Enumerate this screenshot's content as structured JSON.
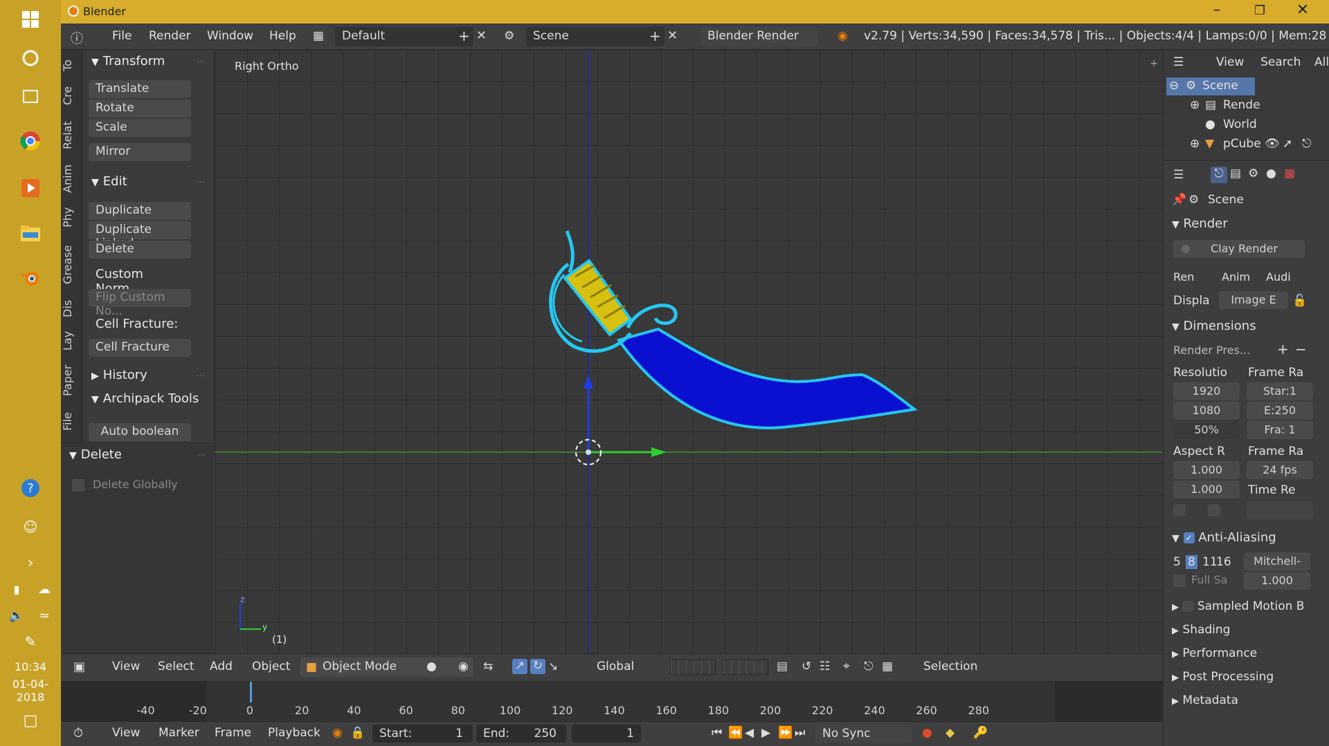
{
  "window": {
    "title": "Blender"
  },
  "taskbar": {
    "time": "10:34",
    "date": "01-04-2018"
  },
  "infobar": {
    "menus": [
      "File",
      "Render",
      "Window",
      "Help"
    ],
    "layout": "Default",
    "scene": "Scene",
    "engine": "Blender Render",
    "stats": "v2.79 | Verts:34,590 | Faces:34,578 | Tris... | Objects:4/4 | Lamps:0/0 | Mem:28"
  },
  "tabs": [
    "To",
    "Cre",
    "Relat",
    "Anim",
    "Phy",
    "Grease",
    "Dis",
    "Lay",
    "Paper",
    "File"
  ],
  "toolshelf": {
    "transform": {
      "title": "Transform",
      "items": [
        "Translate",
        "Rotate",
        "Scale",
        "Mirror"
      ]
    },
    "edit": {
      "title": "Edit",
      "items": [
        "Duplicate",
        "Duplicate Linked",
        "Delete",
        "Custom Norm...",
        "Flip Custom No...",
        "Cell Fracture:",
        "Cell Fracture"
      ]
    },
    "history": "History",
    "archipack": "Archipack Tools",
    "auto_boolean": "Auto boolean",
    "delete": {
      "title": "Delete",
      "option": "Delete Globally"
    }
  },
  "viewport": {
    "view_name": "Right Ortho",
    "frame_label": "(1)",
    "axis_z": "z",
    "axis_y": "y"
  },
  "viewfooter": {
    "menus": [
      "View",
      "Select",
      "Add",
      "Object"
    ],
    "mode": "Object Mode",
    "orientation": "Global",
    "selection": "Selection"
  },
  "timeline": {
    "ticks": [
      "-40",
      "-20",
      "0",
      "20",
      "40",
      "60",
      "80",
      "100",
      "120",
      "140",
      "160",
      "180",
      "200",
      "220",
      "240",
      "260",
      "280"
    ],
    "current_frame": 0
  },
  "tlfooter": {
    "menus": [
      "View",
      "Marker",
      "Frame",
      "Playback"
    ],
    "start_label": "Start:",
    "start": "1",
    "end_label": "End:",
    "end": "250",
    "current": "1",
    "sync": "No Sync"
  },
  "outliner": {
    "menus": [
      "View",
      "Search",
      "All"
    ],
    "items": [
      "Scene",
      "Rende",
      "World",
      "pCube"
    ]
  },
  "properties": {
    "context": "Scene",
    "render_title": "Render",
    "clay_render": "Clay Render",
    "sub_buttons": [
      "Ren",
      "Anim",
      "Audi"
    ],
    "display_label": "Displa",
    "display_value": "Image E",
    "dimensions_title": "Dimensions",
    "render_presets": "Render Pres...",
    "resolution_label": "Resolutio",
    "res_x": "1920",
    "res_y": "1080",
    "res_pct": "50%",
    "frame_range_label": "Frame Ra",
    "frame_start": "Star:1",
    "frame_end": "E:250",
    "frame_step": "Fra: 1",
    "aspect_label": "Aspect R",
    "aspect_x": "1.000",
    "aspect_y": "1.000",
    "frame_rate_label": "Frame Ra",
    "fps": "24 fps",
    "time_remap_label": "Time Re",
    "aa_title": "Anti-Aliasing",
    "aa_samples": [
      "5",
      "8",
      "11",
      "16"
    ],
    "aa_filter": "Mitchell-",
    "full_sample": "Full Sa",
    "aa_size": "1.000",
    "sampled_motion": "Sampled Motion B",
    "shading": "Shading",
    "performance": "Performance",
    "post_processing": "Post Processing",
    "metadata": "Metadata"
  }
}
